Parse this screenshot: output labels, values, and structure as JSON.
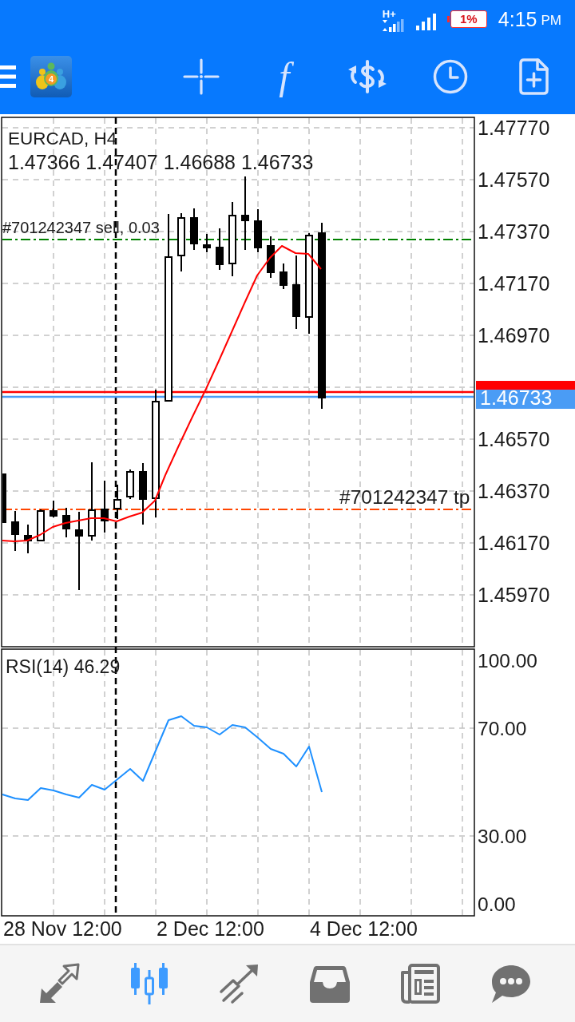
{
  "status_bar": {
    "network": "H+",
    "battery": "1%",
    "time": "4:15",
    "time_suffix": "PM"
  },
  "toolbar": {
    "logo_badge": "4",
    "buttons": [
      {
        "kind": "crosshair"
      },
      {
        "kind": "function",
        "glyph": "f"
      },
      {
        "kind": "trade"
      },
      {
        "kind": "clock"
      },
      {
        "kind": "new-document"
      }
    ]
  },
  "chart": {
    "symbol": "EURCAD, H4",
    "ohlc": "1.47366 1.47407 1.46688 1.46733",
    "orders": [
      {
        "kind": "sell",
        "label": "#701242347 sell, 0.03"
      },
      {
        "kind": "take-profit",
        "label": "#701242347 tp"
      }
    ],
    "price_axis": [
      "1.47770",
      "1.47570",
      "1.47370",
      "1.47170",
      "1.46970",
      "1.46570",
      "1.46370",
      "1.46170",
      "1.45970"
    ],
    "current_price": "1.46733"
  },
  "rsi": {
    "title": "RSI(14) 46.29",
    "axis_labels": [
      "100.00",
      "70.00",
      "30.00",
      "0.00"
    ]
  },
  "time_axis": [
    "28 Nov 12:00",
    "2 Dec 12:00",
    "4 Dec 12:00"
  ],
  "bottom_nav": {
    "items": [
      {
        "kind": "quotes",
        "selected": false
      },
      {
        "kind": "chart",
        "selected": true
      },
      {
        "kind": "trade",
        "selected": false
      },
      {
        "kind": "history",
        "selected": false
      },
      {
        "kind": "news",
        "selected": false
      },
      {
        "kind": "messages",
        "selected": false
      }
    ]
  }
}
